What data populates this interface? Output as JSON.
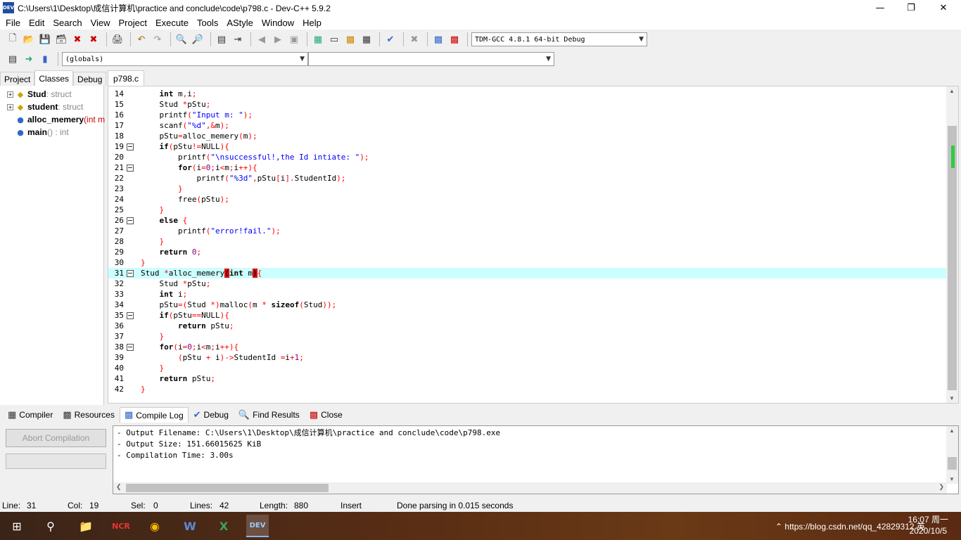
{
  "window": {
    "title": "C:\\Users\\1\\Desktop\\成信计算机\\practice and conclude\\code\\p798.c - Dev-C++ 5.9.2",
    "app_icon_text": "DEV"
  },
  "menu": [
    "File",
    "Edit",
    "Search",
    "View",
    "Project",
    "Execute",
    "Tools",
    "AStyle",
    "Window",
    "Help"
  ],
  "toolbar": {
    "compiler_select": "TDM-GCC 4.8.1 64-bit Debug",
    "scope_select": "(globals)",
    "member_select": ""
  },
  "left_panel": {
    "tabs": [
      "Project",
      "Classes",
      "Debug"
    ],
    "active_tab": "Classes",
    "items": [
      {
        "name": "Stud",
        "type": " : struct",
        "kind": "struct"
      },
      {
        "name": "student",
        "type": " : struct",
        "kind": "struct"
      },
      {
        "name": "alloc_memery",
        "type": "",
        "params": " (int m",
        "kind": "function"
      },
      {
        "name": "main",
        "type": " () : int",
        "kind": "function"
      }
    ]
  },
  "editor": {
    "tab": "p798.c",
    "highlighted_line": 31,
    "lines": [
      {
        "n": "14",
        "fold": false,
        "html": "    <span class='kw'>int</span> m<span class='sym'>,</span>i<span class='sym'>;</span>"
      },
      {
        "n": "15",
        "fold": false,
        "html": "    Stud <span class='sym'>*</span>pStu<span class='sym'>;</span>"
      },
      {
        "n": "16",
        "fold": false,
        "html": "    printf<span class='sym'>(</span><span class='str'>\"Input m: \"</span><span class='sym'>);</span>"
      },
      {
        "n": "17",
        "fold": false,
        "html": "    scanf<span class='sym'>(</span><span class='str'>\"%d\"</span><span class='sym'>,&amp;</span>m<span class='sym'>);</span>"
      },
      {
        "n": "18",
        "fold": false,
        "html": "    pStu<span class='sym'>=</span>alloc_memery<span class='sym'>(</span>m<span class='sym'>);</span>"
      },
      {
        "n": "19",
        "fold": true,
        "html": "    <span class='kw'>if</span><span class='sym'>(</span>pStu<span class='sym'>!=</span>NULL<span class='sym'>){</span>"
      },
      {
        "n": "20",
        "fold": false,
        "html": "        printf<span class='sym'>(</span><span class='str'>\"\\nsuccessful!,the Id intiate: \"</span><span class='sym'>);</span>"
      },
      {
        "n": "21",
        "fold": true,
        "html": "        <span class='kw'>for</span><span class='sym'>(</span>i<span class='sym'>=</span><span class='num'>0</span><span class='sym'>;</span>i<span class='sym'>&lt;</span>m<span class='sym'>;</span>i<span class='sym'>++){</span>"
      },
      {
        "n": "22",
        "fold": false,
        "html": "            printf<span class='sym'>(</span><span class='str'>\"%3d\"</span><span class='sym'>,</span>pStu<span class='sym'>[</span>i<span class='sym'>].</span>StudentId<span class='sym'>);</span>"
      },
      {
        "n": "23",
        "fold": false,
        "html": "        <span class='sym'>}</span>"
      },
      {
        "n": "24",
        "fold": false,
        "html": "        free<span class='sym'>(</span>pStu<span class='sym'>);</span>"
      },
      {
        "n": "25",
        "fold": false,
        "html": "    <span class='sym'>}</span>"
      },
      {
        "n": "26",
        "fold": true,
        "html": "    <span class='kw'>else</span> <span class='sym'>{</span>"
      },
      {
        "n": "27",
        "fold": false,
        "html": "        printf<span class='sym'>(</span><span class='str'>\"error!fail.\"</span><span class='sym'>);</span>"
      },
      {
        "n": "28",
        "fold": false,
        "html": "    <span class='sym'>}</span>"
      },
      {
        "n": "29",
        "fold": false,
        "html": "    <span class='kw'>return</span> <span class='num'>0</span><span class='sym'>;</span>"
      },
      {
        "n": "30",
        "fold": false,
        "html": "<span class='sym'>}</span>"
      },
      {
        "n": "31",
        "fold": true,
        "html": "Stud <span class='sym'>*</span>alloc_memery<span class='sym' style='background:#e00000;color:#000'>(</span><span class='kw'>int</span> m<span class='sym' style='background:#e00000;color:#000'>)</span><span class='sym'>{</span>"
      },
      {
        "n": "32",
        "fold": false,
        "html": "    Stud <span class='sym'>*</span>pStu<span class='sym'>;</span>"
      },
      {
        "n": "33",
        "fold": false,
        "html": "    <span class='kw'>int</span> i<span class='sym'>;</span>"
      },
      {
        "n": "34",
        "fold": false,
        "html": "    pStu<span class='sym'>=(</span>Stud <span class='sym'>*)</span>malloc<span class='sym'>(</span>m <span class='sym'>*</span> <span class='kw'>sizeof</span><span class='sym'>(</span>Stud<span class='sym'>));</span>"
      },
      {
        "n": "35",
        "fold": true,
        "html": "    <span class='kw'>if</span><span class='sym'>(</span>pStu<span class='sym'>==</span>NULL<span class='sym'>){</span>"
      },
      {
        "n": "36",
        "fold": false,
        "html": "        <span class='kw'>return</span> pStu<span class='sym'>;</span>"
      },
      {
        "n": "37",
        "fold": false,
        "html": "    <span class='sym'>}</span>"
      },
      {
        "n": "38",
        "fold": true,
        "html": "    <span class='kw'>for</span><span class='sym'>(</span>i<span class='sym'>=</span><span class='num'>0</span><span class='sym'>;</span>i<span class='sym'>&lt;</span>m<span class='sym'>;</span>i<span class='sym'>++){</span>"
      },
      {
        "n": "39",
        "fold": false,
        "html": "        <span class='sym'>(</span>pStu <span class='sym'>+</span> i<span class='sym'>)-&gt;</span>StudentId <span class='sym'>=</span>i<span class='sym'>+</span><span class='num'>1</span><span class='sym'>;</span>"
      },
      {
        "n": "40",
        "fold": false,
        "html": "    <span class='sym'>}</span>"
      },
      {
        "n": "41",
        "fold": false,
        "html": "    <span class='kw'>return</span> pStu<span class='sym'>;</span>"
      },
      {
        "n": "42",
        "fold": false,
        "html": "<span class='sym'>}</span>"
      }
    ]
  },
  "bottom_tabs": [
    "Compiler",
    "Resources",
    "Compile Log",
    "Debug",
    "Find Results",
    "Close"
  ],
  "bottom_active_tab": "Compile Log",
  "abort_button": "Abort Compilation",
  "log": [
    "- Output Filename: C:\\Users\\1\\Desktop\\成信计算机\\practice and conclude\\code\\p798.exe",
    "- Output Size: 151.66015625 KiB",
    "- Compilation Time: 3.00s"
  ],
  "status": {
    "line_label": "Line:",
    "line": "31",
    "col_label": "Col:",
    "col": "19",
    "sel_label": "Sel:",
    "sel": "0",
    "lines_label": "Lines:",
    "lines": "42",
    "length_label": "Length:",
    "length": "880",
    "mode": "Insert",
    "message": "Done parsing in 0.015 seconds"
  },
  "taskbar": {
    "time": "16:07 周一",
    "date": "2020/10/5",
    "tray_text": "https://blog.csdn.net/qq_42829312",
    "ime": "英"
  },
  "colors": {
    "highlight_line": "#ccffff",
    "keyword": "#000000",
    "string": "#0000ff",
    "symbol": "#ff0000",
    "number": "#800080"
  }
}
